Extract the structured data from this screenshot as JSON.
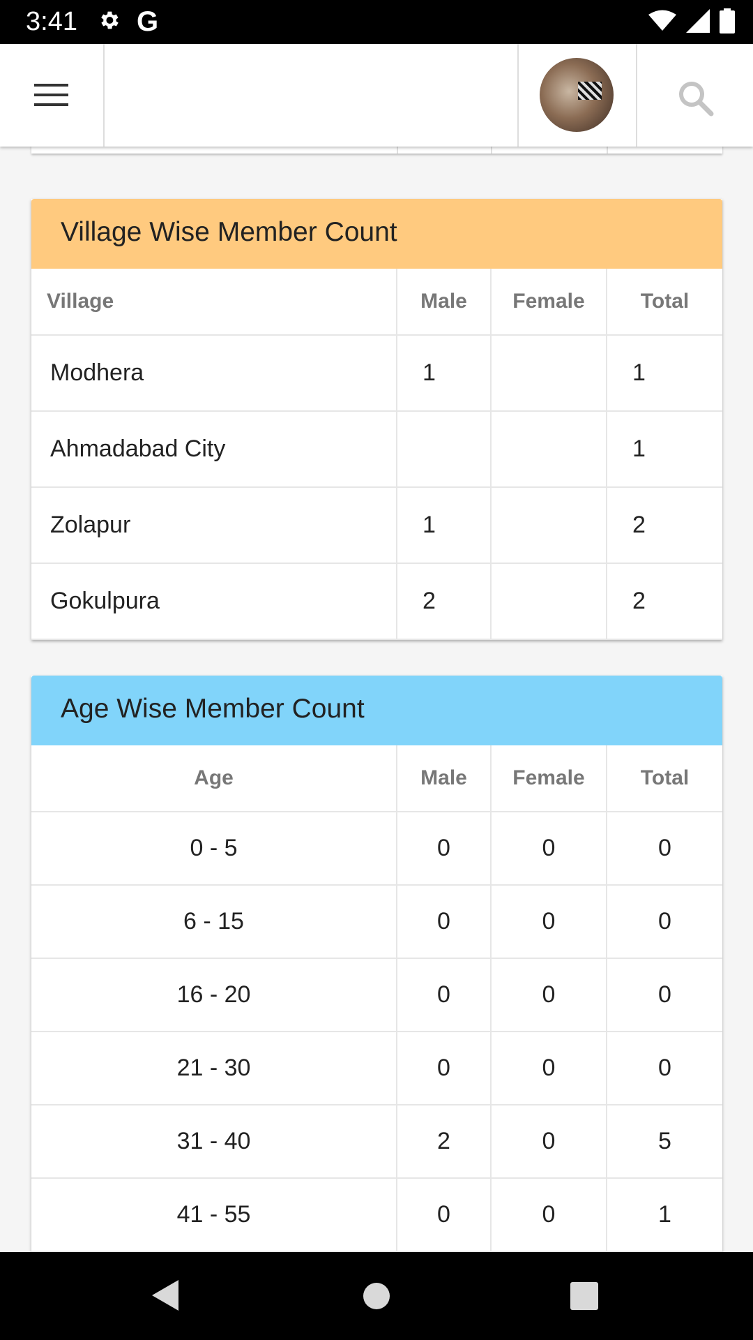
{
  "status_bar": {
    "time": "3:41",
    "g_label": "G"
  },
  "village_card": {
    "title": "Village Wise Member Count",
    "header_color": "#ffca7f",
    "columns": [
      "Village",
      "Male",
      "Female",
      "Total"
    ],
    "rows": [
      [
        "Modhera",
        "1",
        "",
        "1"
      ],
      [
        "Ahmadabad City",
        "",
        "",
        "1"
      ],
      [
        "Zolapur",
        "1",
        "",
        "2"
      ],
      [
        "Gokulpura",
        "2",
        "",
        "2"
      ]
    ]
  },
  "age_card": {
    "title": "Age Wise Member Count",
    "header_color": "#81d4fa",
    "columns": [
      "Age",
      "Male",
      "Female",
      "Total"
    ],
    "rows": [
      [
        "0 - 5",
        "0",
        "0",
        "0"
      ],
      [
        "6 - 15",
        "0",
        "0",
        "0"
      ],
      [
        "16 - 20",
        "0",
        "0",
        "0"
      ],
      [
        "21 - 30",
        "0",
        "0",
        "0"
      ],
      [
        "31 - 40",
        "2",
        "0",
        "5"
      ],
      [
        "41 - 55",
        "0",
        "0",
        "1"
      ]
    ]
  }
}
